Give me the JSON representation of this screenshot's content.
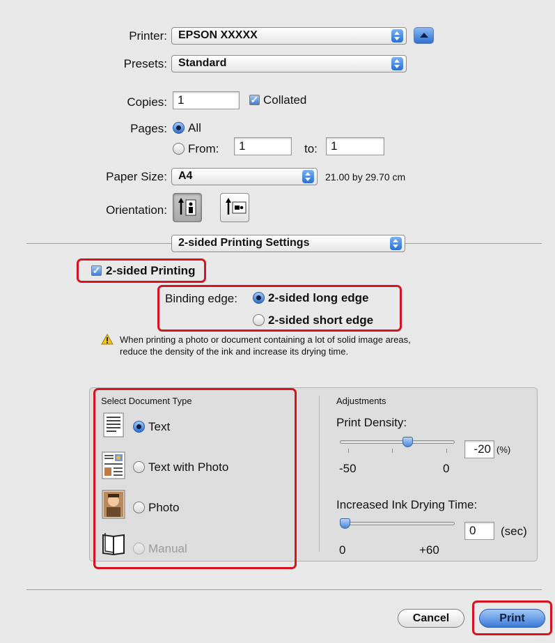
{
  "printer": {
    "label": "Printer:",
    "value": "EPSON XXXXX"
  },
  "presets": {
    "label": "Presets:",
    "value": "Standard"
  },
  "copies": {
    "label": "Copies:",
    "value": "1",
    "collated_label": "Collated",
    "collated": true
  },
  "pages": {
    "label": "Pages:",
    "all_label": "All",
    "from_label": "From:",
    "from_value": "1",
    "to_label": "to:",
    "to_value": "1",
    "selected": "All"
  },
  "paper": {
    "label": "Paper Size:",
    "value": "A4",
    "dimensions": "21.00 by 29.70 cm"
  },
  "orientation": {
    "label": "Orientation:",
    "selected": "portrait"
  },
  "panel_menu": {
    "value": "2-sided Printing Settings"
  },
  "two_sided": {
    "label": "2-sided Printing",
    "checked": true
  },
  "binding": {
    "label": "Binding edge:",
    "long_label": "2-sided long edge",
    "short_label": "2-sided short edge",
    "selected": "long"
  },
  "warning": {
    "line1": "When printing a photo or document containing a lot of solid image areas,",
    "line2": "reduce the density of the ink and increase its drying time."
  },
  "doc_type": {
    "title": "Select Document Type",
    "items": [
      {
        "label": "Text",
        "selected": true,
        "enabled": true,
        "icon": "text-document-icon"
      },
      {
        "label": "Text with Photo",
        "selected": false,
        "enabled": true,
        "icon": "text-with-photo-icon"
      },
      {
        "label": "Photo",
        "selected": false,
        "enabled": true,
        "icon": "photo-icon"
      },
      {
        "label": "Manual",
        "selected": false,
        "enabled": false,
        "icon": "manual-book-icon"
      }
    ]
  },
  "adjustments": {
    "title": "Adjustments",
    "density": {
      "label": "Print Density:",
      "value": "-20",
      "unit": "(%)",
      "min_label": "-50",
      "max_label": "0",
      "level": 0.6
    },
    "drying": {
      "label": "Increased Ink Drying Time:",
      "value": "0",
      "unit": "(sec)",
      "min_label": "0",
      "max_label": "+60",
      "level": 0.0
    }
  },
  "buttons": {
    "cancel": "Cancel",
    "print": "Print"
  },
  "colors": {
    "highlight": "#d4141f",
    "accent": "#2f6fd0"
  }
}
